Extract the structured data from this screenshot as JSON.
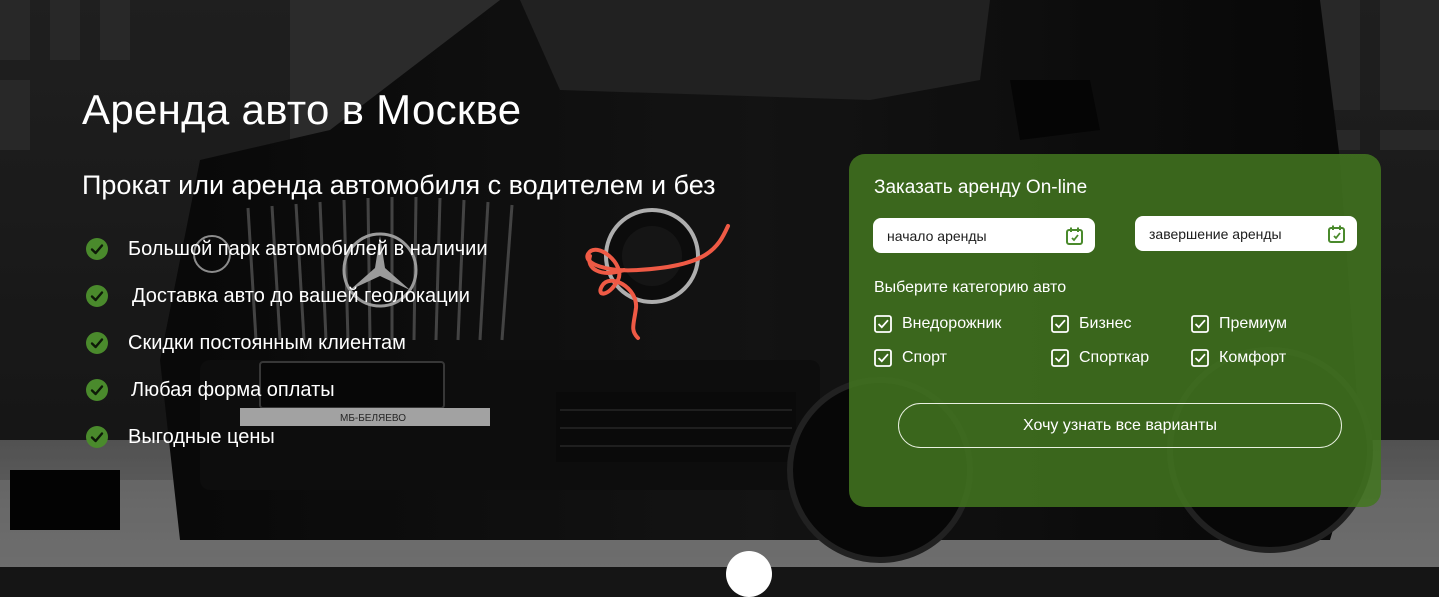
{
  "hero": {
    "title": "Аренда авто в Москве",
    "subtitle": "Прокат или аренда автомобиля с водителем и без",
    "features": [
      "Большой парк автомобилей в наличии",
      "Доставка авто до вашей геолокации",
      "Скидки постоянным клиентам",
      "Любая форма оплаты",
      "Выгодные цены"
    ],
    "plate_text": "МБ-БЕЛЯЕВО"
  },
  "booking": {
    "title": "Заказать аренду On-line",
    "start_label": "начало аренды",
    "end_label": "завершение аренды",
    "category_label": "Выберите категорию авто",
    "categories": [
      "Внедорожник",
      "Бизнес",
      "Премиум",
      "Спорт",
      "Спорткар",
      "Комфорт"
    ],
    "cta_label": "Хочу узнать все варианты"
  },
  "icons": {
    "feature": "green-check-circle-icon",
    "date": "calendar-icon",
    "category": "checkbox-checked-icon"
  },
  "colors": {
    "panel": "#42761f",
    "check": "#4a8a2c",
    "scribble": "#ef5a45",
    "text": "#ffffff"
  }
}
